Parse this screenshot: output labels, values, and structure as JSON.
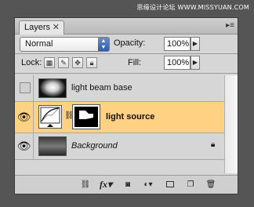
{
  "watermark": "思缘设计论坛 WWW.MISSYUAN.COM",
  "panel": {
    "tab_label": "Layers",
    "close_glyph": "✕",
    "menu_glyph": "▸≡"
  },
  "controls": {
    "blend_mode": "Normal",
    "opacity_label": "Opacity:",
    "opacity_value": "100%",
    "lock_label": "Lock:",
    "fill_label": "Fill:",
    "fill_value": "100%"
  },
  "layers": [
    {
      "name": "light beam base",
      "visible": false,
      "active": false,
      "italic": false,
      "locked": false
    },
    {
      "name": "light source",
      "visible": true,
      "active": true,
      "italic": false,
      "locked": false,
      "has_adjustment": true,
      "has_mask": true
    },
    {
      "name": "Background",
      "visible": true,
      "active": false,
      "italic": true,
      "locked": true
    }
  ],
  "footer": {
    "link_icon": "link-layers-icon",
    "fx_label": "fx",
    "mask_icon": "add-mask-icon",
    "adjustment_icon": "adjustment-layer-icon",
    "group_icon": "new-group-icon",
    "new_layer_icon": "new-layer-icon",
    "trash_icon": "trash-icon"
  },
  "colors": {
    "active_row": "#ffd183",
    "panel_bg": "#d6d6d6",
    "desktop_bg": "#555555"
  }
}
